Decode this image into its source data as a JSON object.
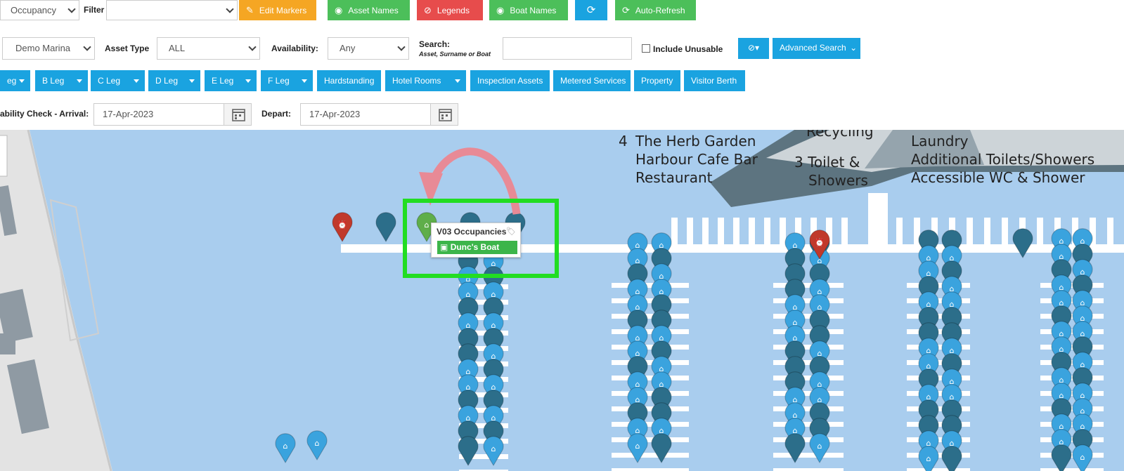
{
  "toolbar": {
    "mode_select": "Occupancy",
    "filter_label": "Filter",
    "filter_value": "",
    "edit_markers": "Edit Markers",
    "asset_names": "Asset Names",
    "legends": "Legends",
    "boat_names": "Boat Names",
    "auto_refresh": "Auto-Refresh"
  },
  "search_row": {
    "marina": "Demo Marina",
    "asset_type_label": "Asset Type",
    "asset_type": "ALL",
    "availability_label": "Availability:",
    "availability": "Any",
    "search_label": "Search:",
    "search_hint": "Asset, Surname or Boat",
    "search_value": "",
    "include_unusable": "Include Unusable",
    "advanced_search": "Advanced Search"
  },
  "legs": [
    {
      "label": "eg"
    },
    {
      "label": "B Leg"
    },
    {
      "label": "C Leg"
    },
    {
      "label": "D Leg"
    },
    {
      "label": "E Leg"
    },
    {
      "label": "F Leg"
    },
    {
      "label": "Hardstanding"
    },
    {
      "label": "Hotel Rooms"
    },
    {
      "label": "Inspection Assets"
    },
    {
      "label": "Metered Services"
    },
    {
      "label": "Property"
    },
    {
      "label": "Visitor Berth"
    }
  ],
  "dates": {
    "arrival_label": "ability Check - Arrival:",
    "arrival": "17-Apr-2023",
    "depart_label": "Depart:",
    "depart": "17-Apr-2023"
  },
  "map": {
    "labels": {
      "herb_num": "4",
      "herb1": "The Herb Garden",
      "herb2": "Harbour Cafe Bar",
      "herb3": "Restaurant",
      "recycling": "Recycling",
      "toilet1": "3  Toilet &",
      "toilet2": "Showers",
      "laundry": "Laundry",
      "additional": "Additional Toilets/Showers",
      "accessible": "Accessible WC & Shower"
    },
    "popup": {
      "title": "V03 Occupancies",
      "boat": "Dunc's Boat"
    }
  },
  "colors": {
    "water": "#a9cdee",
    "dark_pin": "#2c6e8a",
    "light_pin": "#3aa3de",
    "red_pin": "#c0392b",
    "green_pin": "#5fae4a",
    "highlight": "#22dd22"
  }
}
